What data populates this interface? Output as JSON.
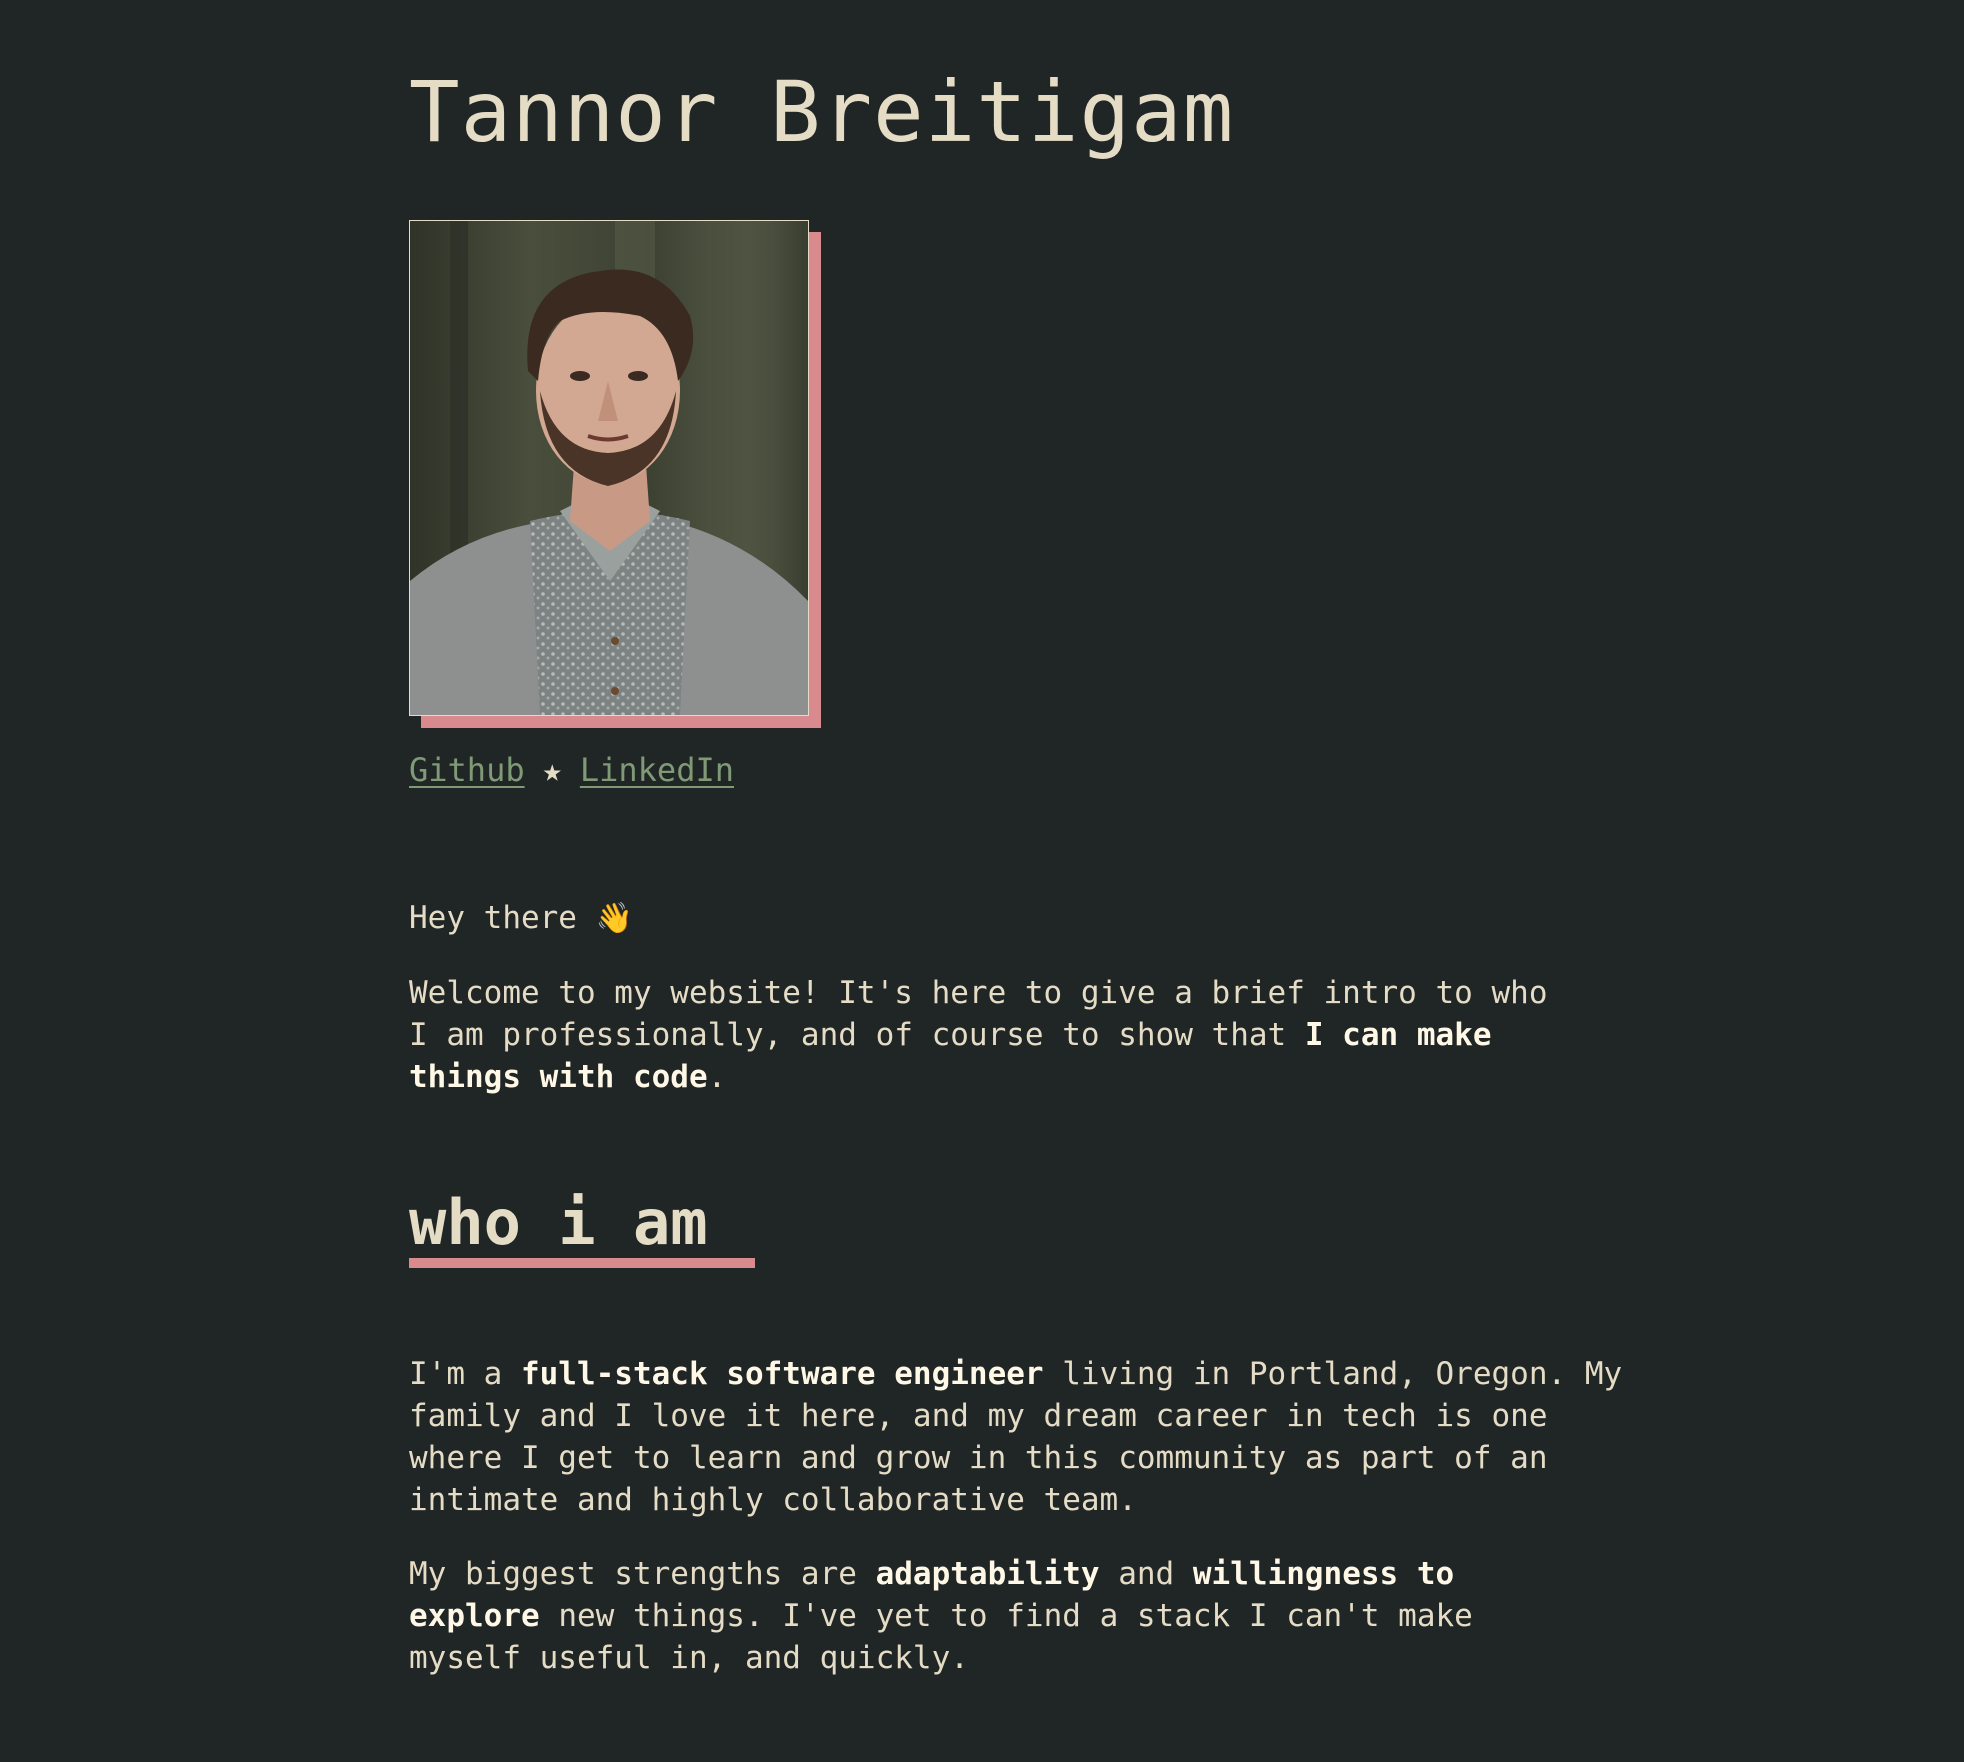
{
  "header": {
    "name": "Tannor Breitigam"
  },
  "portrait": {
    "alt": "Portrait of Tannor Breitigam",
    "accent_color": "#d98a8e"
  },
  "links": {
    "github": "Github",
    "separator": "★",
    "linkedin": "LinkedIn",
    "color": "#7f9a75"
  },
  "intro": {
    "greeting": "Hey there",
    "wave_icon": "👋",
    "welcome_text": "Welcome to my website! It's here to give a brief intro to who I am professionally, and of course to show that ",
    "welcome_bold": "I can make things with code",
    "welcome_end": "."
  },
  "who_i_am": {
    "heading": "who i am",
    "p1_start": "I'm a ",
    "p1_bold": "full-stack software engineer",
    "p1_rest": " living in Portland, Oregon. My family and I love it here, and my dream career in tech is one where I get to learn and grow in this community as part of an intimate and highly collaborative team.",
    "p2_start": "My biggest strengths are ",
    "p2_bold1": "adaptability",
    "p2_mid": " and ",
    "p2_bold2": "willingness to explore",
    "p2_rest": " new things. I've yet to find a stack I can't make myself useful in, and quickly."
  },
  "colors": {
    "background": "#202526",
    "text": "#e5dcc6",
    "accent": "#d98a8e",
    "link": "#7f9a75"
  }
}
